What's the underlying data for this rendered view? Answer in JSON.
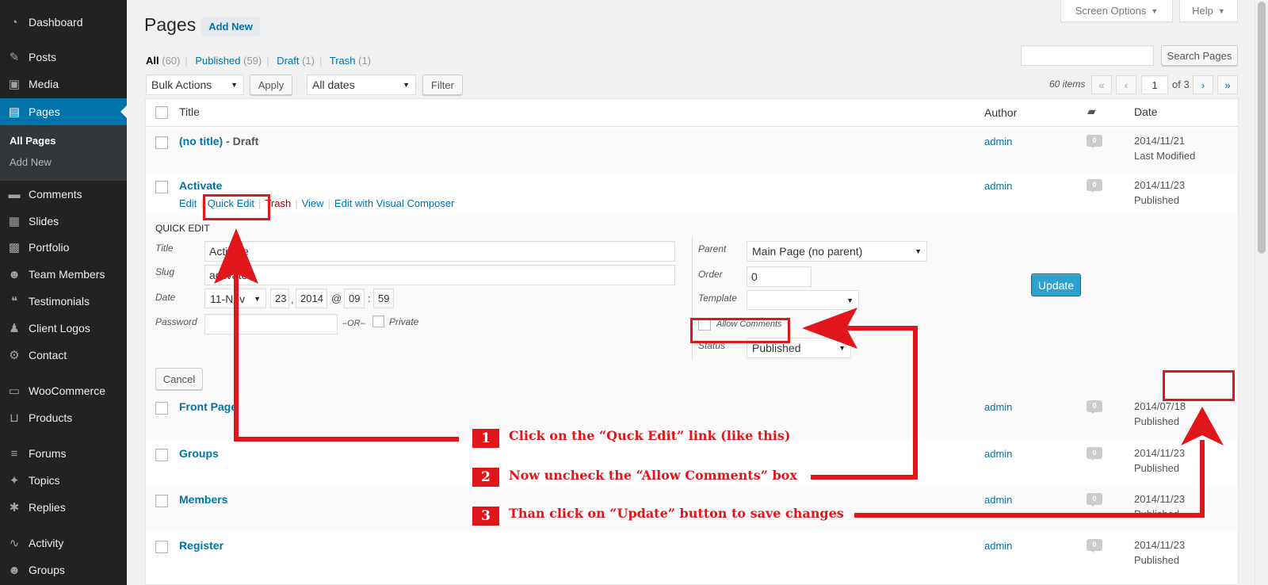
{
  "sidebar": {
    "items": [
      {
        "label": "Dashboard",
        "icon": "dashboard-icon",
        "glyph": "◔"
      },
      {
        "label": "Posts",
        "icon": "pin-icon",
        "glyph": "✎"
      },
      {
        "label": "Media",
        "icon": "media-icon",
        "glyph": "▣"
      },
      {
        "label": "Pages",
        "icon": "pages-icon",
        "glyph": "▤"
      },
      {
        "label": "Comments",
        "icon": "comments-icon",
        "glyph": "▬"
      },
      {
        "label": "Slides",
        "icon": "slides-icon",
        "glyph": "▦"
      },
      {
        "label": "Portfolio",
        "icon": "portfolio-icon",
        "glyph": "▩"
      },
      {
        "label": "Team Members",
        "icon": "team-icon",
        "glyph": "☻"
      },
      {
        "label": "Testimonials",
        "icon": "testimonials-icon",
        "glyph": "❝"
      },
      {
        "label": "Client Logos",
        "icon": "client-logos-icon",
        "glyph": "♟"
      },
      {
        "label": "Contact",
        "icon": "gear-icon",
        "glyph": "⚙"
      },
      {
        "label": "WooCommerce",
        "icon": "woocommerce-icon",
        "glyph": "▭"
      },
      {
        "label": "Products",
        "icon": "cart-icon",
        "glyph": "⊔"
      },
      {
        "label": "Forums",
        "icon": "forums-icon",
        "glyph": "≡"
      },
      {
        "label": "Topics",
        "icon": "topics-icon",
        "glyph": "✦"
      },
      {
        "label": "Replies",
        "icon": "replies-icon",
        "glyph": "✱"
      },
      {
        "label": "Activity",
        "icon": "activity-icon",
        "glyph": "∿"
      },
      {
        "label": "Groups",
        "icon": "groups-icon",
        "glyph": "☻"
      }
    ],
    "submenu": {
      "all_pages": "All Pages",
      "add_new": "Add New"
    }
  },
  "header": {
    "screen_options": "Screen Options",
    "help": "Help",
    "title": "Pages",
    "add_new": "Add New"
  },
  "filters": {
    "all": "All",
    "all_count": "(60)",
    "published": "Published",
    "published_count": "(59)",
    "draft": "Draft",
    "draft_count": "(1)",
    "trash": "Trash",
    "trash_count": "(1)"
  },
  "search": {
    "button": "Search Pages",
    "value": ""
  },
  "toolbar": {
    "bulk_actions": "Bulk Actions",
    "apply": "Apply",
    "all_dates": "All dates",
    "filter": "Filter"
  },
  "pagination": {
    "items": "60 items",
    "first": "«",
    "prev": "‹",
    "current_page": "1",
    "of": "of 3",
    "next": "›",
    "last": "»"
  },
  "table": {
    "columns": {
      "title": "Title",
      "author": "Author",
      "date": "Date"
    },
    "rows": [
      {
        "title": "(no title)",
        "state": " - Draft",
        "author": "admin",
        "comments": "0",
        "date": "2014/11/21",
        "status": "Last Modified"
      },
      {
        "title": "Activate",
        "state": "",
        "author": "admin",
        "comments": "0",
        "date": "2014/11/23",
        "status": "Published"
      },
      {
        "title": "Front Page",
        "state": "",
        "author": "admin",
        "comments": "0",
        "date": "2014/07/18",
        "status": "Published"
      },
      {
        "title": "Groups",
        "state": "",
        "author": "admin",
        "comments": "0",
        "date": "2014/11/23",
        "status": "Published"
      },
      {
        "title": "Members",
        "state": "",
        "author": "admin",
        "comments": "0",
        "date": "2014/11/23",
        "status": "Published"
      },
      {
        "title": "Register",
        "state": "",
        "author": "admin",
        "comments": "0",
        "date": "2014/11/23",
        "status": "Published"
      }
    ],
    "row_actions": {
      "edit": "Edit",
      "quick_edit": "Quick Edit",
      "trash": "Trash",
      "view": "View",
      "edit_vc": "Edit with Visual Composer"
    }
  },
  "quick_edit": {
    "heading": "QUICK EDIT",
    "title_label": "Title",
    "title_value": "Activate",
    "slug_label": "Slug",
    "slug_value": "activate",
    "date_label": "Date",
    "month": "11-Nov",
    "day": "23",
    "year": "2014",
    "at": "@",
    "hour": "09",
    "colon": ":",
    "minute": "59",
    "comma": ",",
    "password_label": "Password",
    "or_label": "–OR–",
    "private_label": "Private",
    "parent_label": "Parent",
    "parent_value": "Main Page (no parent)",
    "order_label": "Order",
    "order_value": "0",
    "template_label": "Template",
    "template_value": "",
    "allow_comments_label": "Allow Comments",
    "status_label": "Status",
    "status_value": "Published",
    "cancel": "Cancel",
    "update": "Update"
  },
  "annotations": {
    "step1_num": "1",
    "step1_text": "Click on the “Quck Edit” link (like this)",
    "step2_num": "2",
    "step2_text": "Now uncheck the “Allow Comments” box",
    "step3_num": "3",
    "step3_text": "Than click on “Update” button to save changes",
    "color": "#e1161b"
  }
}
